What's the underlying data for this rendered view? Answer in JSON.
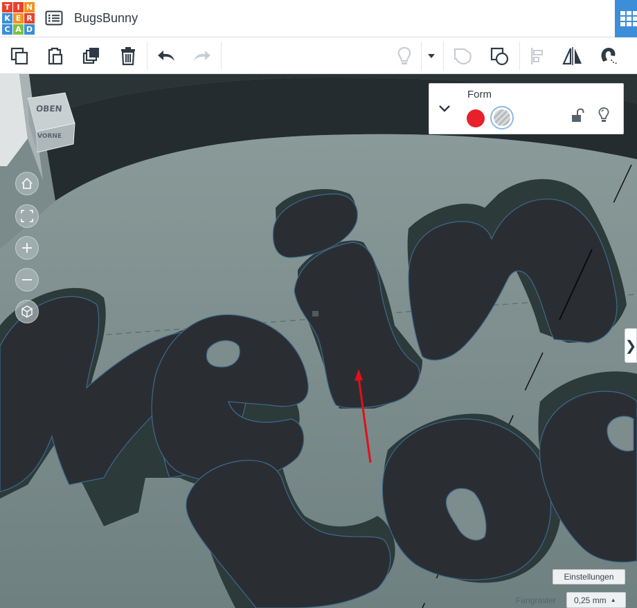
{
  "header": {
    "logo_letters": [
      "T",
      "I",
      "N",
      "K",
      "E",
      "R",
      "C",
      "A",
      "D"
    ],
    "logo_colors": [
      "#e8412c",
      "#e8412c",
      "#f5921e",
      "#3c8fd6",
      "#f5921e",
      "#e8412c",
      "#3c8fd6",
      "#7ac142",
      "#3c8fd6"
    ],
    "design_title": "BugsBunny",
    "accent_color": "#3d8ed8"
  },
  "toolbar": {
    "icons": [
      "copy-icon",
      "paste-icon",
      "duplicate-icon",
      "delete-icon",
      "undo-icon",
      "redo-icon",
      "light-bulb-icon",
      "dropdown-caret-icon",
      "group-icon",
      "ungroup-icon",
      "align-icon",
      "mirror-icon",
      "magnet-icon"
    ]
  },
  "viewcube": {
    "top_label": "OBEN",
    "front_label": "VORNE"
  },
  "shape_panel": {
    "title": "Form",
    "solid_color": "#e8202a",
    "hole_option": "hole"
  },
  "bottom": {
    "settings_label": "Einstellungen",
    "snap_label": "Fangraster",
    "snap_value": "0,25 mm"
  }
}
